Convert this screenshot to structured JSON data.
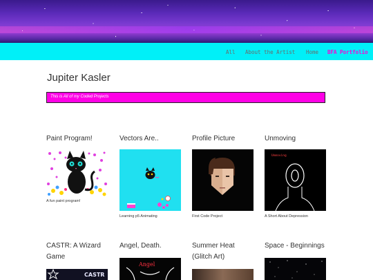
{
  "nav": {
    "items": [
      {
        "label": "All"
      },
      {
        "label": "About the Artist"
      },
      {
        "label": "Home"
      },
      {
        "label": "BFA Portfolio"
      }
    ]
  },
  "site": {
    "title": "Jupiter Kasler",
    "tagline": "This is All of my Coded Projects"
  },
  "projects": [
    {
      "title": "Paint Program!",
      "caption": "A fun paint program!"
    },
    {
      "title": "Vectors Are..",
      "caption": "Learning p5 Animating"
    },
    {
      "title": "Profile Picture",
      "caption": "First Code Project"
    },
    {
      "title": "Unmoving",
      "caption": "A Short About Depression",
      "thumb_text": "Unmoving"
    },
    {
      "title": "CASTR: A Wizard Game",
      "thumb_text": "CASTR"
    },
    {
      "title": "Angel, Death.",
      "thumb_text": "Angel"
    },
    {
      "title": "Summer Heat (Glitch Art)"
    },
    {
      "title": "Space - Beginnings"
    }
  ],
  "colors": {
    "navbar": "#00f0f8",
    "active_nav": "#ff00d4",
    "tagline_bg": "#ff00e6"
  }
}
